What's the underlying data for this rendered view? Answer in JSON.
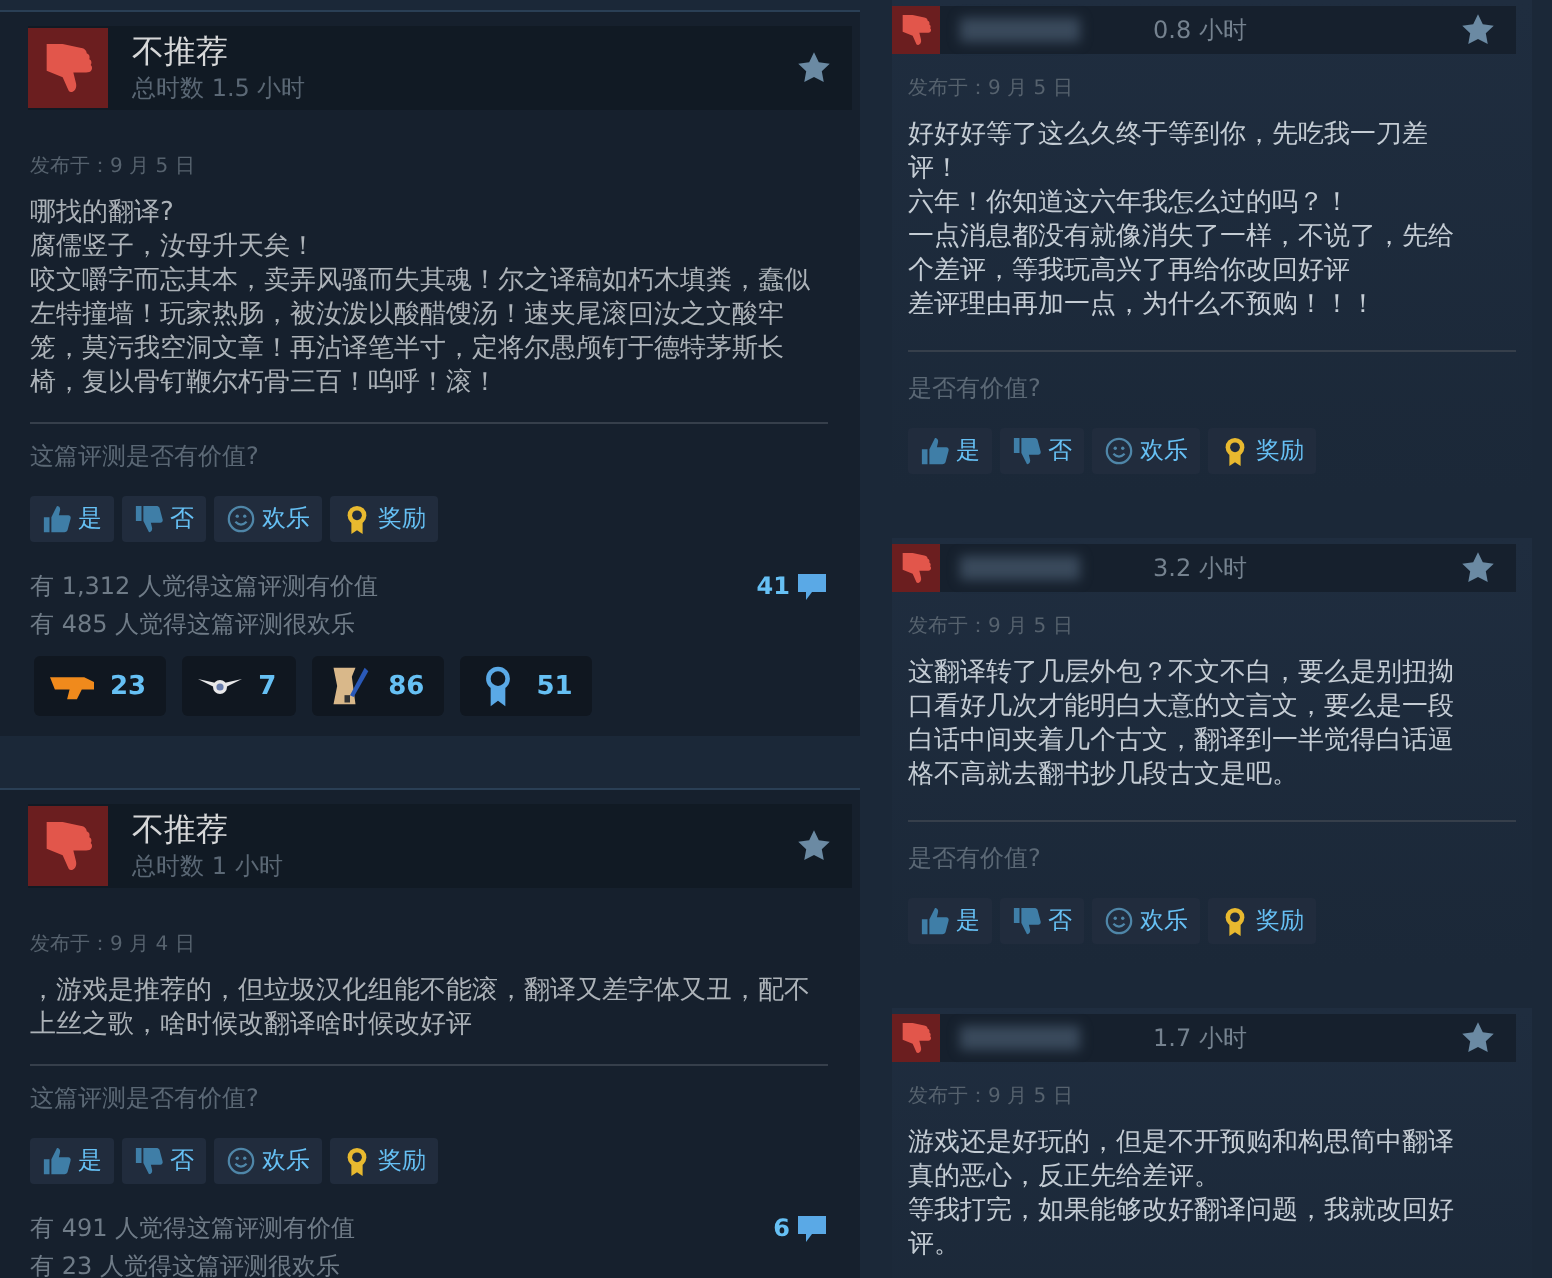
{
  "main_reviews": [
    {
      "verdict": "不推荐",
      "hours": "总时数 1.5 小时",
      "posted": "发布于：9 月 5 日",
      "paragraphs": [
        "哪找的翻译?",
        "腐儒竖子，汝母升天矣！",
        "咬文嚼字而忘其本，卖弄风骚而失其魂！尔之译稿如朽木填粪，蠢似左特撞墙！玩家热肠，被汝泼以酸醋馊汤！速夹尾滚回汝之文酸牢笼，莫污我空洞文章！再沾译笔半寸，定将尔愚颅钉于德特茅斯长椅，复以骨钉鞭尔朽骨三百！呜呼！滚！"
      ],
      "helpful_prompt": "这篇评测是否有价值?",
      "buttons": [
        {
          "kind": "yes",
          "label": "是"
        },
        {
          "kind": "no",
          "label": "否"
        },
        {
          "kind": "funny",
          "label": "欢乐"
        },
        {
          "kind": "award",
          "label": "奖励"
        }
      ],
      "stats": [
        "有 1,312 人觉得这篇评测有价值",
        "有 485 人觉得这篇评测很欢乐"
      ],
      "comments": "41",
      "awards": [
        {
          "kind": "blaster",
          "count": "23"
        },
        {
          "kind": "wings",
          "count": "7"
        },
        {
          "kind": "scroll",
          "count": "86"
        },
        {
          "kind": "medal",
          "count": "51"
        }
      ]
    },
    {
      "verdict": "不推荐",
      "hours": "总时数 1 小时",
      "posted": "发布于：9 月 4 日",
      "paragraphs": [
        "，游戏是推荐的，但垃圾汉化组能不能滚，翻译又差字体又丑，配不上丝之歌，啥时候改翻译啥时候改好评"
      ],
      "helpful_prompt": "这篇评测是否有价值?",
      "buttons": [
        {
          "kind": "yes",
          "label": "是"
        },
        {
          "kind": "no",
          "label": "否"
        },
        {
          "kind": "funny",
          "label": "欢乐"
        },
        {
          "kind": "award",
          "label": "奖励"
        }
      ],
      "stats": [
        "有 491 人觉得这篇评测有价值",
        "有 23 人觉得这篇评测很欢乐"
      ],
      "comments": "6"
    }
  ],
  "side_reviews": [
    {
      "hours": "0.8 小时",
      "posted": "发布于：9 月 5 日",
      "paragraphs": [
        "好好好等了这么久终于等到你，先吃我一刀差评！",
        "六年！你知道这六年我怎么过的吗？！",
        "一点消息都没有就像消失了一样，不说了，先给个差评，等我玩高兴了再给你改回好评",
        "差评理由再加一点，为什么不预购！！！"
      ],
      "helpful_prompt": "是否有价值?",
      "buttons": [
        {
          "kind": "yes",
          "label": "是"
        },
        {
          "kind": "no",
          "label": "否"
        },
        {
          "kind": "funny",
          "label": "欢乐"
        },
        {
          "kind": "award",
          "label": "奖励"
        }
      ]
    },
    {
      "hours": "3.2 小时",
      "posted": "发布于：9 月 5 日",
      "paragraphs": [
        "这翻译转了几层外包？不文不白，要么是别扭拗口看好几次才能明白大意的文言文，要么是一段白话中间夹着几个古文，翻译到一半觉得白话逼格不高就去翻书抄几段古文是吧。"
      ],
      "helpful_prompt": "是否有价值?",
      "buttons": [
        {
          "kind": "yes",
          "label": "是"
        },
        {
          "kind": "no",
          "label": "否"
        },
        {
          "kind": "funny",
          "label": "欢乐"
        },
        {
          "kind": "award",
          "label": "奖励"
        }
      ]
    },
    {
      "hours": "1.7 小时",
      "posted": "发布于：9 月 5 日",
      "paragraphs": [
        "游戏还是好玩的，但是不开预购和构思简中翻译真的恶心，反正先给差评。",
        "等我打完，如果能够改好翻译问题，我就改回好评。"
      ]
    }
  ]
}
